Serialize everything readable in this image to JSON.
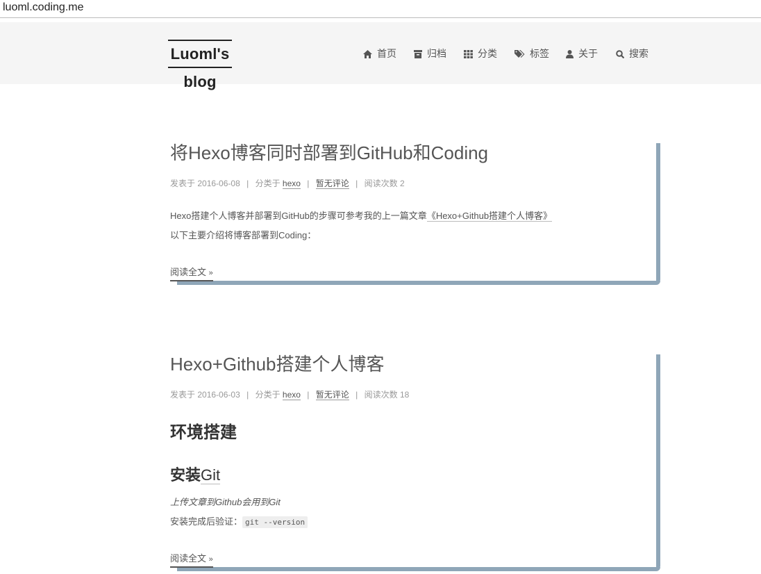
{
  "browser": {
    "url": "luoml.coding.me"
  },
  "site": {
    "title": "Luoml's blog"
  },
  "menu": [
    {
      "label": "首页",
      "icon": "home-icon"
    },
    {
      "label": "归档",
      "icon": "archive-icon"
    },
    {
      "label": "分类",
      "icon": "th-icon"
    },
    {
      "label": "标签",
      "icon": "tags-icon"
    },
    {
      "label": "关于",
      "icon": "user-icon"
    },
    {
      "label": "搜索",
      "icon": "search-icon"
    }
  ],
  "posts": [
    {
      "title": "将Hexo博客同时部署到GitHub和Coding",
      "meta": {
        "posted_prefix": "发表于",
        "date": "2016-06-08",
        "category_prefix": "分类于",
        "category": "hexo",
        "comments": "暂无评论",
        "views_prefix": "阅读次数",
        "views": "2"
      },
      "excerpt_line1_prefix": "Hexo搭建个人博客并部署到GitHub的步骤可参考我的上一篇文章",
      "excerpt_line1_link": "《Hexo+Github搭建个人博客》",
      "excerpt_line2": "以下主要介绍将博客部署到Coding：",
      "read_more": "阅读全文",
      "read_more_arrow": "»"
    },
    {
      "title": "Hexo+Github搭建个人博客",
      "meta": {
        "posted_prefix": "发表于",
        "date": "2016-06-03",
        "category_prefix": "分类于",
        "category": "hexo",
        "comments": "暂无评论",
        "views_prefix": "阅读次数",
        "views": "18"
      },
      "h2": "环境搭建",
      "h3_prefix": "安装",
      "h3_link": "Git",
      "italic_line": "上传文章到Github会用到Git",
      "verify_prefix": "安装完成后验证：",
      "verify_code": "git --version",
      "read_more": "阅读全文",
      "read_more_arrow": "»"
    }
  ]
}
